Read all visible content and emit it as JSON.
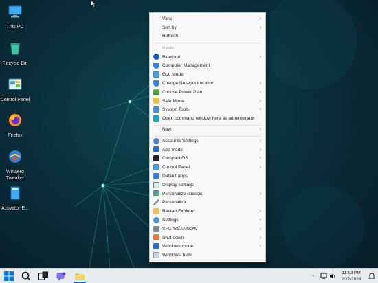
{
  "desktop": {
    "icons": [
      {
        "label": "This PC",
        "icon": "computer-icon"
      },
      {
        "label": "Recycle Bin",
        "icon": "recycle-bin-icon"
      },
      {
        "label": "Control Panel",
        "icon": "control-panel-icon"
      },
      {
        "label": "Firefox",
        "icon": "firefox-icon"
      },
      {
        "label": "Winaero Tweaker",
        "icon": "winaero-tweaker-icon"
      },
      {
        "label": "Activator-E...",
        "icon": "activator-icon"
      }
    ]
  },
  "menu": {
    "items": [
      {
        "label": "View",
        "submenu": true
      },
      {
        "label": "Sort by",
        "submenu": true
      },
      {
        "label": "Refresh",
        "submenu": false
      },
      {
        "label": "Paste",
        "submenu": false,
        "disabled": true
      },
      {
        "label": "Bluetooth",
        "submenu": true,
        "icon": "bluetooth-icon"
      },
      {
        "label": "Computer Management",
        "submenu": false,
        "icon": "shield-icon"
      },
      {
        "label": "God Mode",
        "submenu": false,
        "icon": "control-panel-icon"
      },
      {
        "label": "Change Network Location",
        "submenu": true,
        "icon": "shield-icon"
      },
      {
        "label": "Choose Power Plan",
        "submenu": true,
        "icon": "power-plan-icon"
      },
      {
        "label": "Safe Mode",
        "submenu": true,
        "icon": "safe-mode-icon"
      },
      {
        "label": "System Tools",
        "submenu": true,
        "icon": "system-tools-icon"
      },
      {
        "label": "Open command window here as administrator",
        "submenu": false,
        "icon": "command-prompt-icon"
      },
      {
        "label": "New",
        "submenu": true
      },
      {
        "label": "Accounts Settings",
        "submenu": true,
        "icon": "accounts-icon"
      },
      {
        "label": "App mode",
        "submenu": true,
        "icon": "app-mode-icon"
      },
      {
        "label": "Compact OS",
        "submenu": true,
        "icon": "compact-os-icon"
      },
      {
        "label": "Control Panel",
        "submenu": true,
        "icon": "control-panel-icon"
      },
      {
        "label": "Default apps",
        "submenu": false,
        "icon": "default-apps-icon"
      },
      {
        "label": "Display settings",
        "submenu": false,
        "icon": "display-icon"
      },
      {
        "label": "Personalize (classic)",
        "submenu": true,
        "icon": "personalize-icon"
      },
      {
        "label": "Personalize",
        "submenu": false,
        "icon": "brush-icon"
      },
      {
        "label": "Restart Explorer",
        "submenu": true,
        "icon": "restart-explorer-icon"
      },
      {
        "label": "Settings",
        "submenu": true,
        "icon": "gear-icon"
      },
      {
        "label": "SFC /SCANNOW",
        "submenu": true,
        "icon": "sfc-icon"
      },
      {
        "label": "Shut down",
        "submenu": true,
        "icon": "power-icon"
      },
      {
        "label": "Windows mode",
        "submenu": true,
        "icon": "windows-mode-icon"
      },
      {
        "label": "Windows Tools",
        "submenu": false,
        "icon": "windows-tools-icon"
      }
    ]
  },
  "taskbar": {
    "apps": [
      {
        "icon": "start-icon"
      },
      {
        "icon": "search-icon"
      },
      {
        "icon": "task-view-icon"
      },
      {
        "icon": "chat-icon"
      },
      {
        "icon": "file-explorer-icon"
      }
    ],
    "tray": {
      "chevron": "^"
    },
    "clock": {
      "time": "11:18 PM",
      "date": "2/22/2026"
    }
  },
  "colors": {
    "accent": "#0078d4",
    "menu_bg": "#f9f9f9",
    "taskbar_bg": "#e6ecf0"
  }
}
